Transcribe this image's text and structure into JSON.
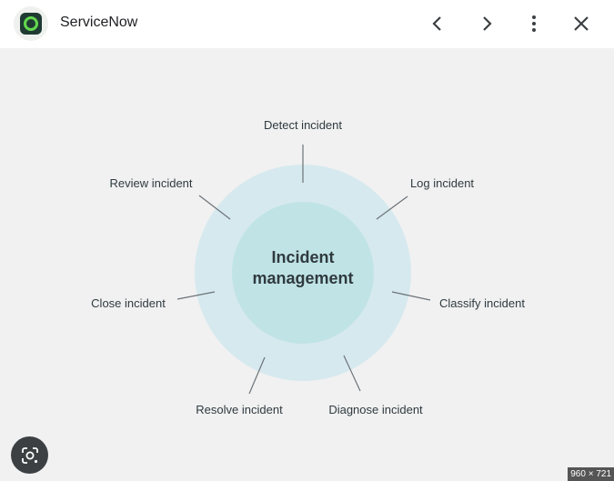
{
  "header": {
    "title": "ServiceNow",
    "logo_icon": "servicenow-logo-icon",
    "back_icon": "chevron-left-icon",
    "forward_icon": "chevron-right-icon",
    "menu_icon": "more-vert-icon",
    "close_icon": "close-icon"
  },
  "diagram": {
    "center_line1": "Incident",
    "center_line2": "management",
    "steps": [
      "Detect incident",
      "Log incident",
      "Classify incident",
      "Diagnose incident",
      "Resolve incident",
      "Close incident",
      "Review incident"
    ]
  },
  "footer": {
    "lens_icon": "lens-search-icon",
    "image_dims": "960 × 721"
  },
  "colors": {
    "outer_ring": "#d6e9ee",
    "inner_circle": "#c0e3e6",
    "text": "#2f3a3e",
    "connector": "#6c7377",
    "logo_green": "#62d84e"
  }
}
